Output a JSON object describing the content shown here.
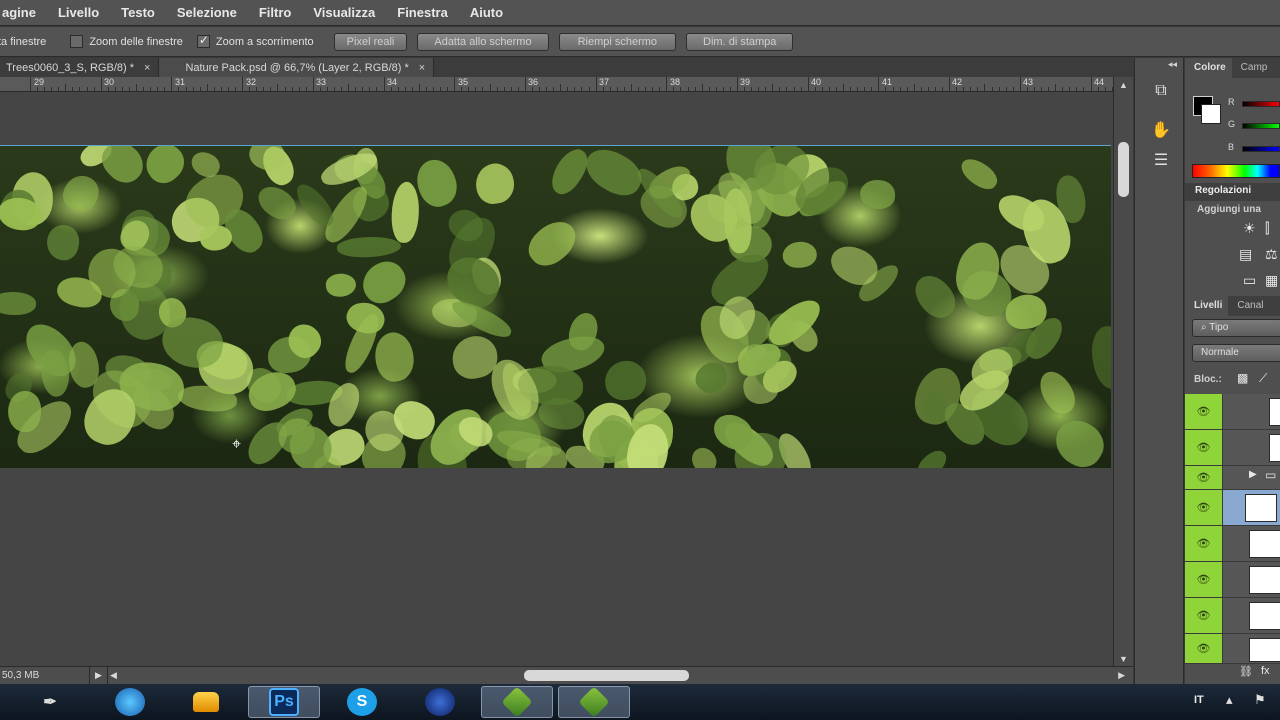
{
  "menubar": {
    "items": [
      "agine",
      "Livello",
      "Testo",
      "Selezione",
      "Filtro",
      "Visualizza",
      "Finestra",
      "Aiuto"
    ]
  },
  "options": {
    "check1_label": "ta finestre",
    "check2_label": "Zoom delle finestre",
    "check3_label": "Zoom a scorrimento",
    "btn_pixel": "Pixel reali",
    "btn_fit": "Adatta allo schermo",
    "btn_fill": "Riempi schermo",
    "btn_print": "Dim. di stampa"
  },
  "tabs": [
    {
      "label": "Trees0060_3_S, RGB/8) *",
      "close": "×"
    },
    {
      "label": "Nature Pack.psd @ 66,7% (Layer 2, RGB/8) *",
      "close": "×"
    }
  ],
  "ruler": {
    "numbers": [
      "29",
      "30",
      "31",
      "32",
      "33",
      "34",
      "35",
      "36",
      "37",
      "38",
      "39",
      "40",
      "41",
      "42",
      "43",
      "44"
    ]
  },
  "status": {
    "doc_size": "50,3 MB",
    "play_icon": "play-icon"
  },
  "panels": {
    "color_tab": "Colore",
    "swatches_tab": "Camp",
    "r_label": "R",
    "g_label": "G",
    "b_label": "B",
    "adjust_title": "Regolazioni",
    "adjust_sub": "Aggiungi una",
    "layers_tab": "Livelli",
    "channels_tab": "Canal",
    "kind_select": "Tipo",
    "blend_select": "Normale",
    "lock_label": "Bloc.:"
  },
  "taskbar": {
    "lang": "IT",
    "apps": [
      "pen-tool-icon",
      "browser-icon",
      "folder-icon",
      "photoshop-icon",
      "skype-icon",
      "cinema4d-icon",
      "app-icon-1",
      "app-icon-2"
    ],
    "ps_label": "Ps"
  }
}
